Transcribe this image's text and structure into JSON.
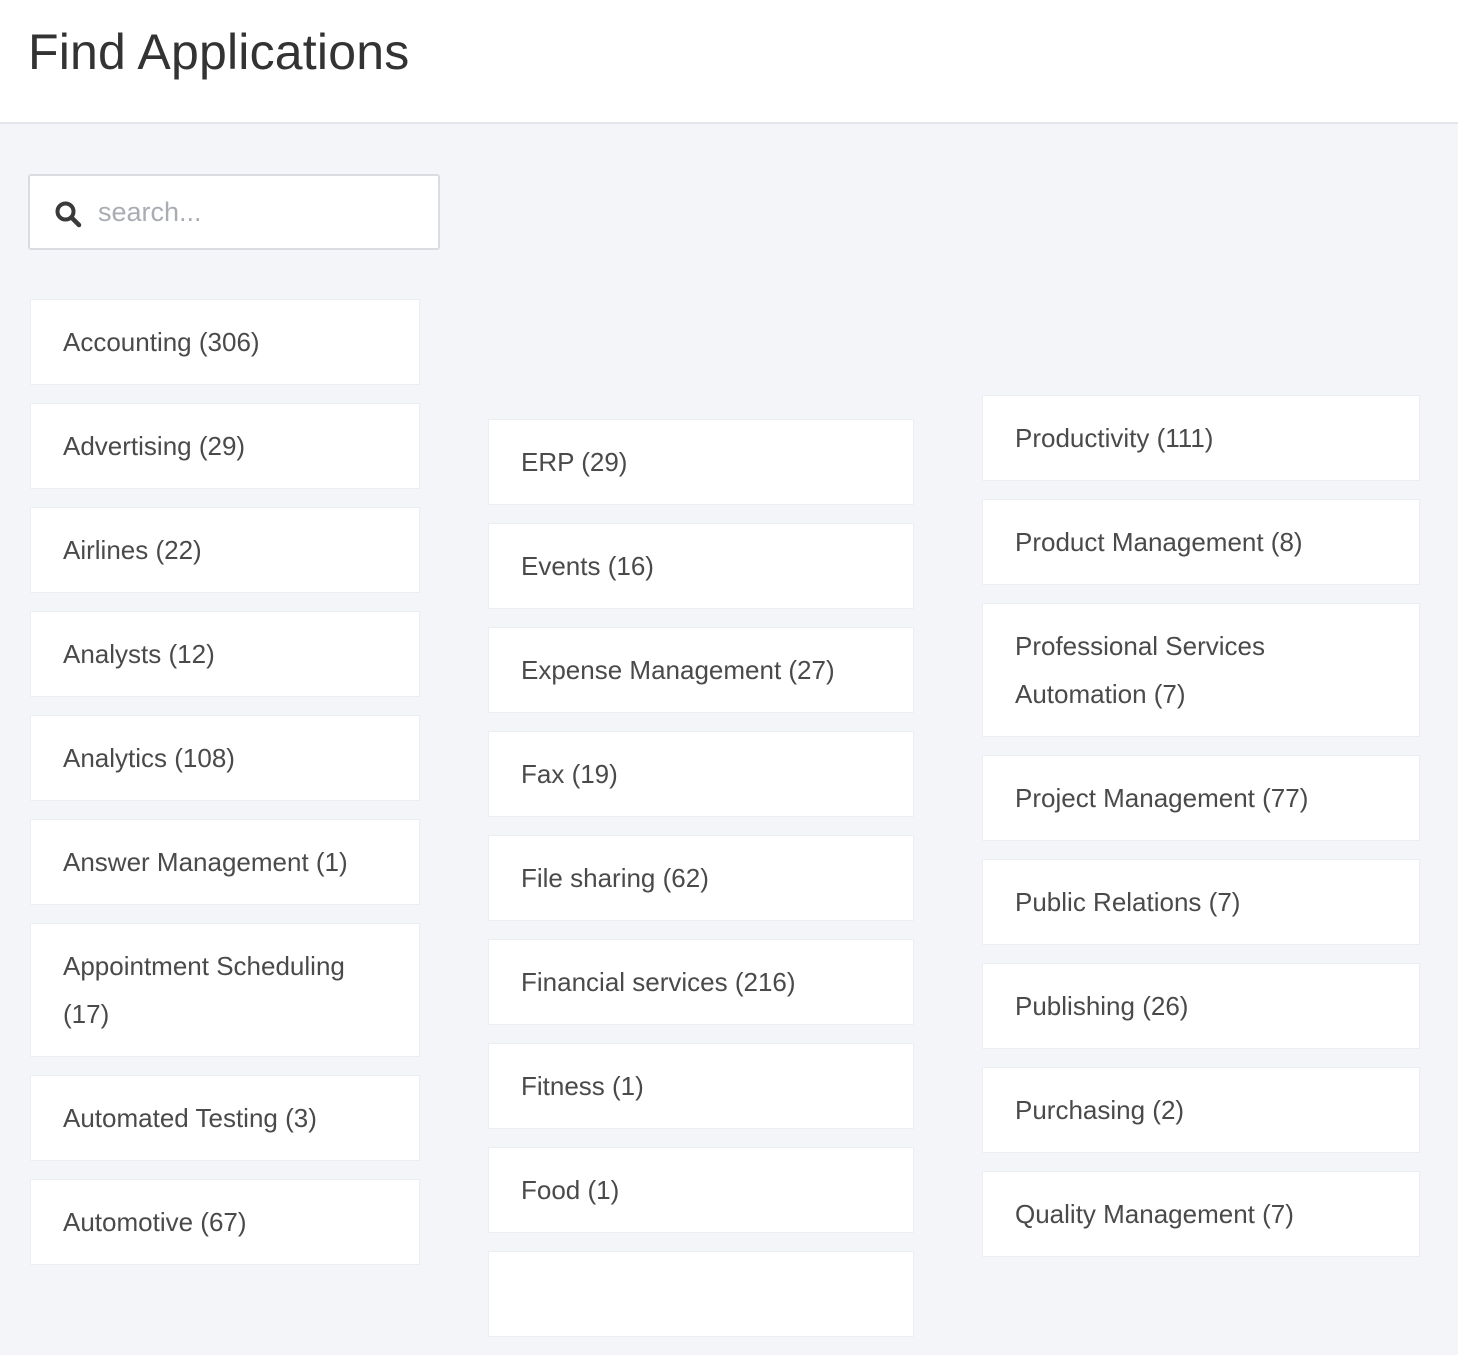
{
  "header": {
    "title": "Find Applications"
  },
  "search": {
    "placeholder": "search...",
    "value": ""
  },
  "columns": [
    {
      "items": [
        "Accounting (306)",
        "Advertising (29)",
        "Airlines (22)",
        "Analysts (12)",
        "Analytics (108)",
        "Answer Management (1)",
        "Appointment Scheduling (17)",
        "Automated Testing (3)",
        "Automotive (67)"
      ]
    },
    {
      "items": [
        "ERP (29)",
        "Events (16)",
        "Expense Management (27)",
        "Fax (19)",
        "File sharing (62)",
        "Financial services (216)",
        "Fitness (1)",
        "Food (1)",
        ""
      ]
    },
    {
      "items": [
        "Productivity (111)",
        "Product Management (8)",
        "Professional Services Automation (7)",
        "Project Management (77)",
        "Public Relations (7)",
        "Publishing (26)",
        "Purchasing (2)",
        "Quality Management (7)"
      ]
    }
  ],
  "colors": {
    "background": "#f3f5f8",
    "card": "#ffffff",
    "text": "#4a4a4a",
    "title": "#333333"
  },
  "icons": {
    "search": "search-icon"
  }
}
